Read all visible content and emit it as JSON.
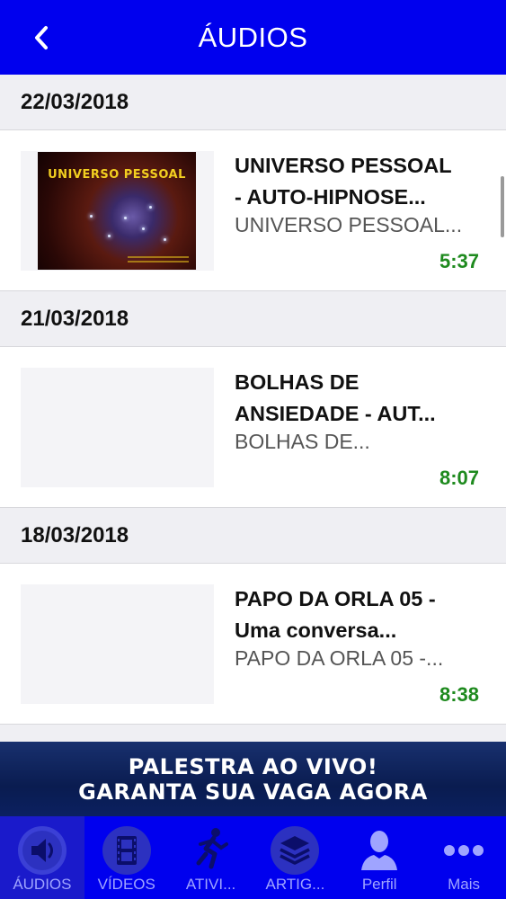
{
  "header": {
    "title": "ÁUDIOS",
    "back_icon": "chevron-left-icon"
  },
  "feed": [
    {
      "date": "22/03/2018",
      "title_line1": "UNIVERSO PESSOAL",
      "title_line2": "- AUTO-HIPNOSE...",
      "subtitle": "UNIVERSO PESSOAL...",
      "duration": "5:37",
      "thumbnail_text": "UNIVERSO PESSOAL"
    },
    {
      "date": "21/03/2018",
      "title_line1": "BOLHAS DE",
      "title_line2": "ANSIEDADE - AUT...",
      "subtitle": "BOLHAS DE...",
      "duration": "8:07"
    },
    {
      "date": "18/03/2018",
      "title_line1": "PAPO DA ORLA 05 -",
      "title_line2": "Uma conversa...",
      "subtitle": "PAPO DA ORLA 05 -...",
      "duration": "8:38"
    }
  ],
  "banner": {
    "line1": "PALESTRA AO VIVO!",
    "line2": "GARANTA SUA VAGA AGORA"
  },
  "tabs": [
    {
      "label": "ÁUDIOS",
      "icon": "speaker-icon",
      "active": true
    },
    {
      "label": "VÍDEOS",
      "icon": "film-icon",
      "active": false
    },
    {
      "label": "ATIVI...",
      "icon": "running-person-icon",
      "active": false
    },
    {
      "label": "ARTIG...",
      "icon": "layers-icon",
      "active": false
    },
    {
      "label": "Perfil",
      "icon": "person-icon",
      "active": false
    },
    {
      "label": "Mais",
      "icon": "more-dots-icon",
      "active": false
    }
  ],
  "colors": {
    "primary": "#0000ee",
    "duration": "#1e8a1e",
    "tab_label": "#9fa4ff"
  }
}
